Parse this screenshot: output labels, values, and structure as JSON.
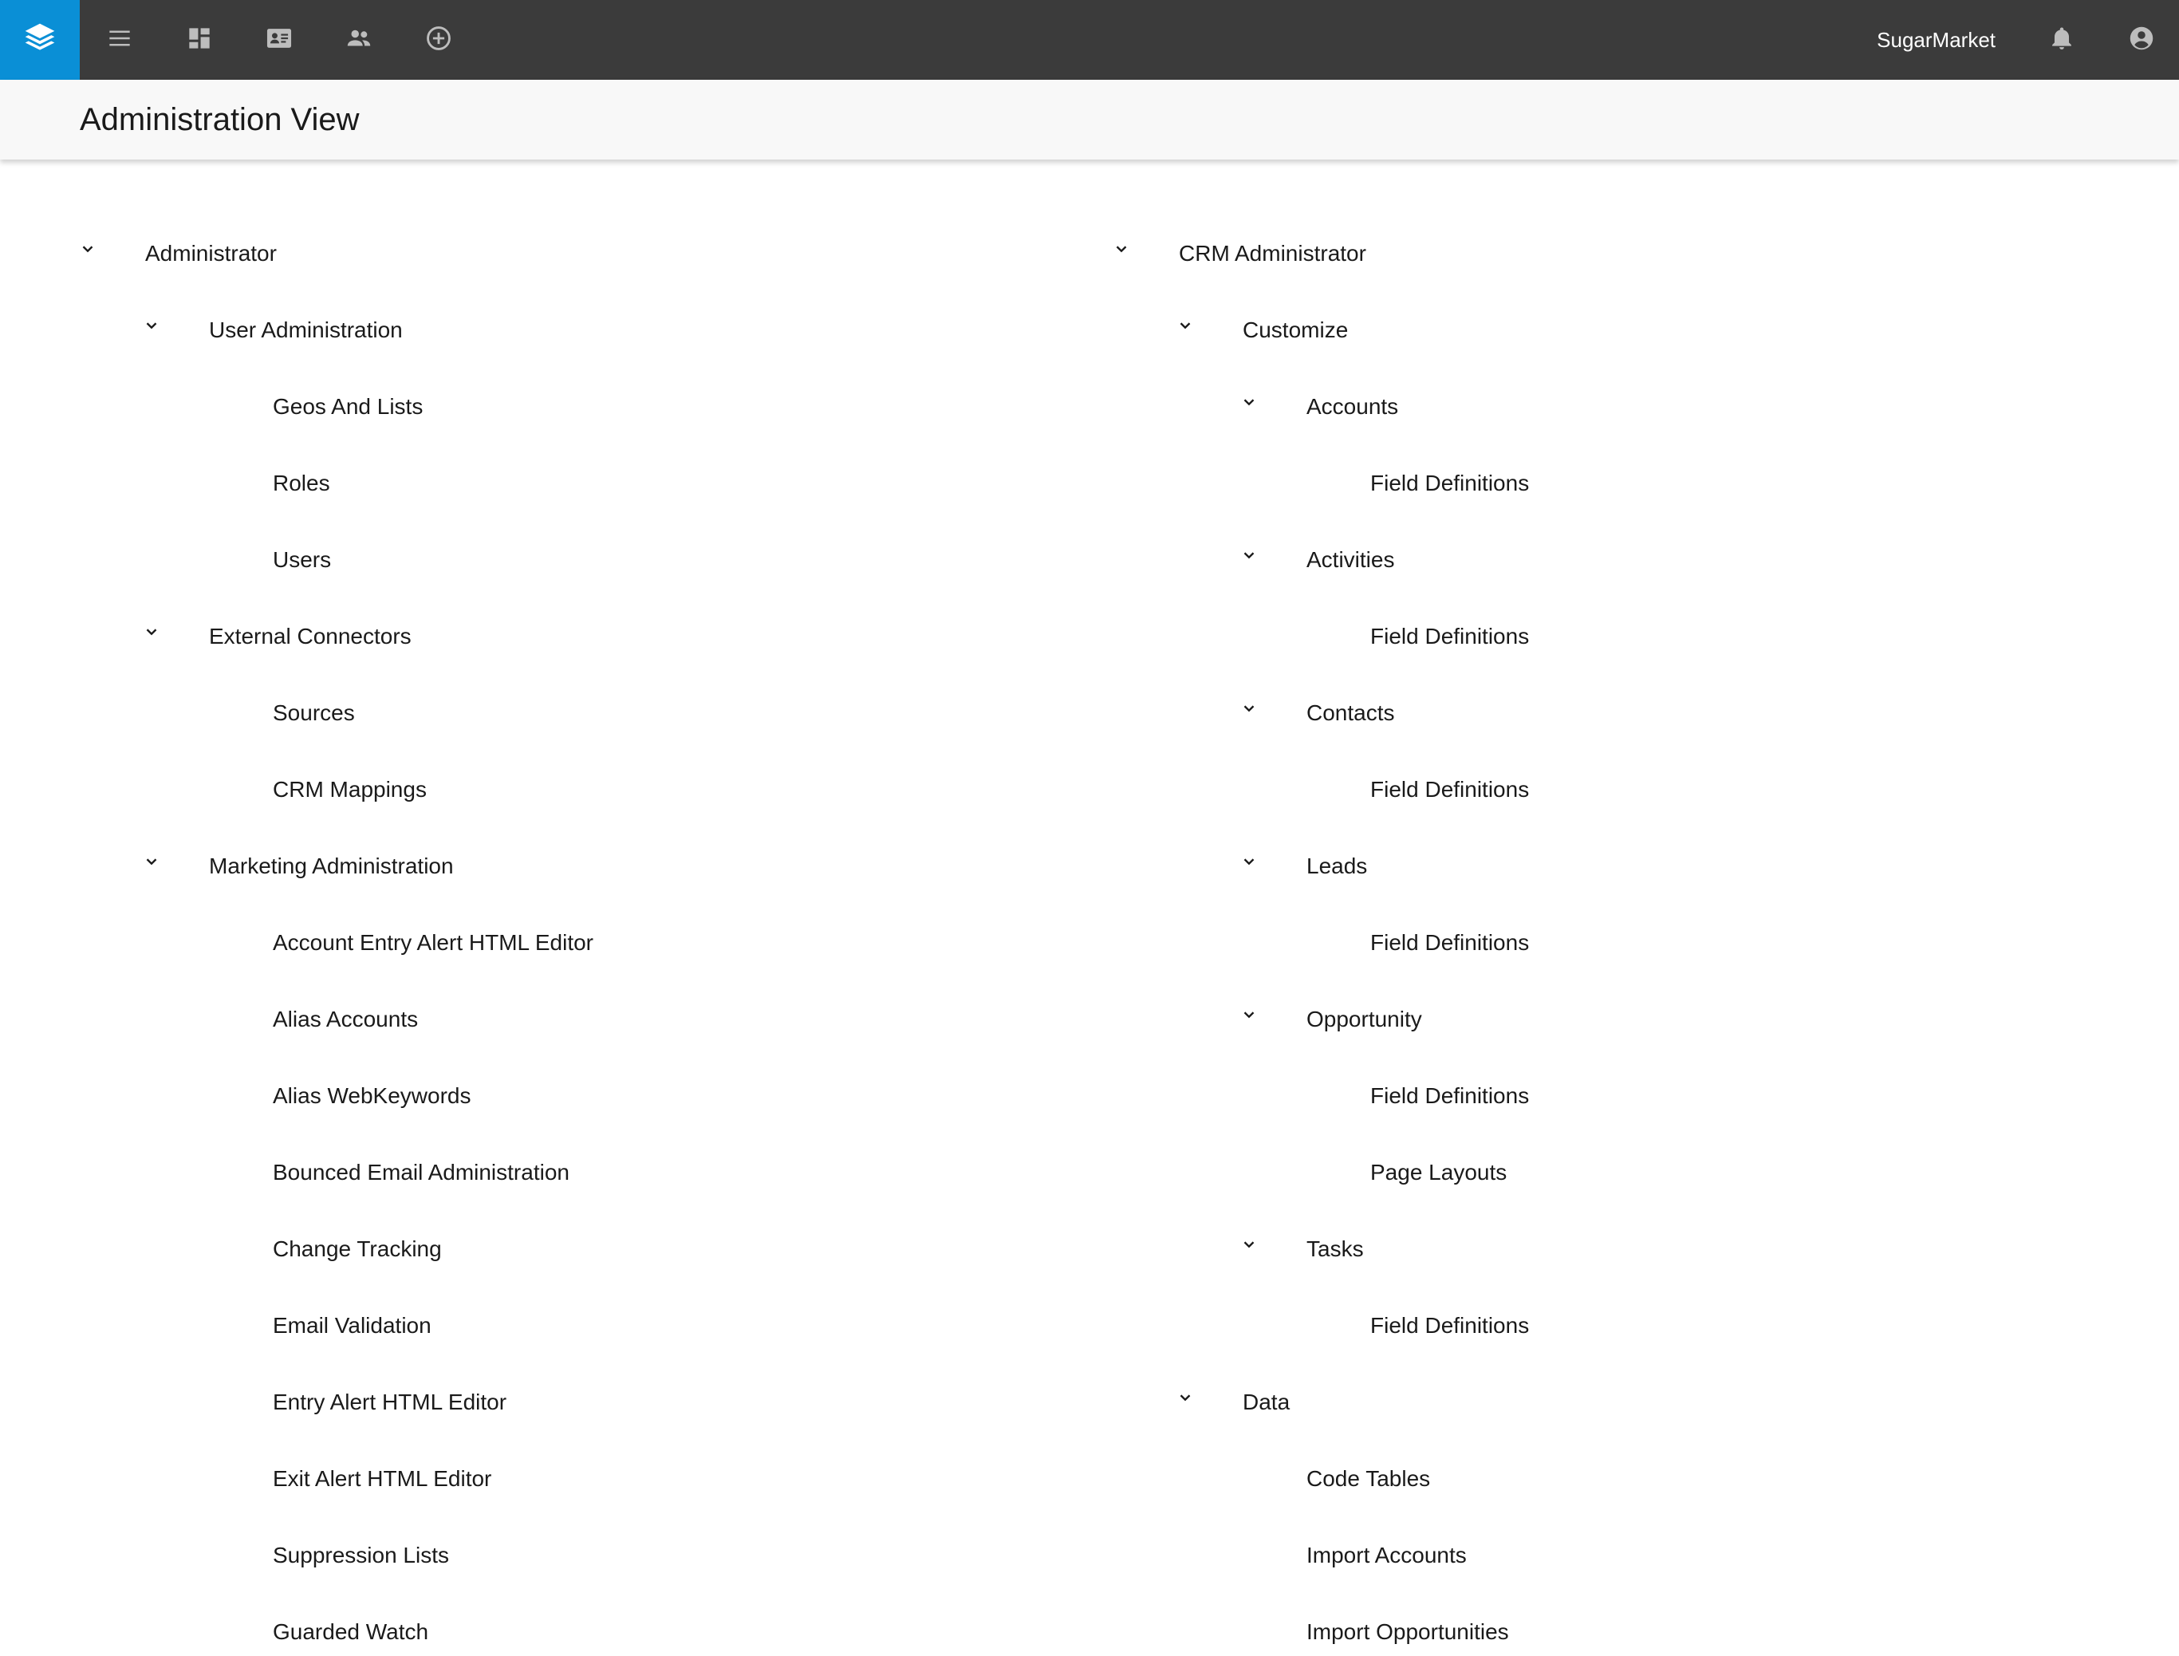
{
  "topbar": {
    "brand_label": "SugarMarket",
    "accent_color": "#0a8fd6",
    "bar_color": "#3b3b3b",
    "icons": [
      "stack-logo-icon",
      "menu-icon",
      "dashboard-icon",
      "contact-card-icon",
      "people-icon",
      "add-circle-icon",
      "bell-icon",
      "account-circle-icon"
    ]
  },
  "header": {
    "title": "Administration View"
  },
  "left_tree": {
    "root": {
      "label": "Administrator",
      "expanded": true
    },
    "groups": [
      {
        "label": "User Administration",
        "expanded": true,
        "items": [
          "Geos And Lists",
          "Roles",
          "Users"
        ]
      },
      {
        "label": "External Connectors",
        "expanded": true,
        "items": [
          "Sources",
          "CRM Mappings"
        ]
      },
      {
        "label": "Marketing Administration",
        "expanded": true,
        "items": [
          "Account Entry Alert HTML Editor",
          "Alias Accounts",
          "Alias WebKeywords",
          "Bounced Email Administration",
          "Change Tracking",
          "Email Validation",
          "Entry Alert HTML Editor",
          "Exit Alert HTML Editor",
          "Suppression Lists",
          "Guarded Watch"
        ]
      }
    ]
  },
  "right_tree": {
    "root": {
      "label": "CRM Administrator",
      "expanded": true
    },
    "customize": {
      "label": "Customize",
      "expanded": true,
      "modules": [
        {
          "label": "Accounts",
          "expanded": true,
          "items": [
            "Field Definitions"
          ]
        },
        {
          "label": "Activities",
          "expanded": true,
          "items": [
            "Field Definitions"
          ]
        },
        {
          "label": "Contacts",
          "expanded": true,
          "items": [
            "Field Definitions"
          ]
        },
        {
          "label": "Leads",
          "expanded": true,
          "items": [
            "Field Definitions"
          ]
        },
        {
          "label": "Opportunity",
          "expanded": true,
          "items": [
            "Field Definitions",
            "Page Layouts"
          ]
        },
        {
          "label": "Tasks",
          "expanded": true,
          "items": [
            "Field Definitions"
          ]
        }
      ]
    },
    "data": {
      "label": "Data",
      "expanded": true,
      "items": [
        "Code Tables",
        "Import Accounts",
        "Import Opportunities"
      ]
    }
  }
}
